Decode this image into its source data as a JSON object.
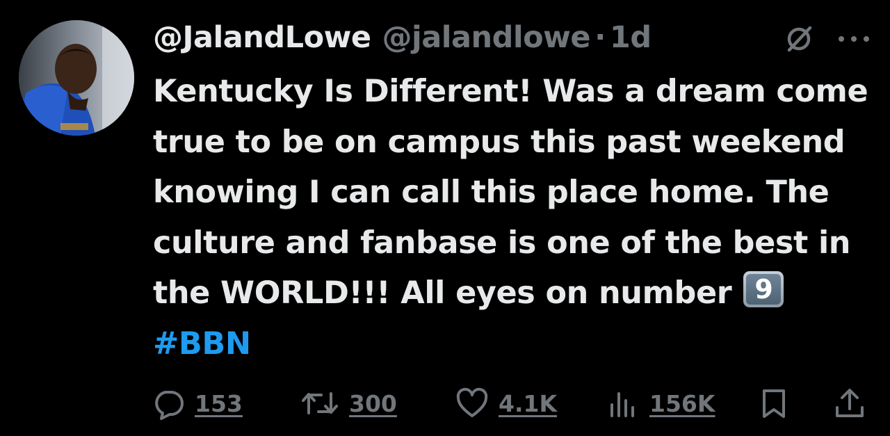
{
  "author": {
    "display_name": "@JalandLowe",
    "handle": "@jalandlowe",
    "separator": "·",
    "time": "1d",
    "avatar": "profile-photo"
  },
  "tweet": {
    "text_before": "Kentucky Is Different! Was a dream come true to be on campus this past weekend knowing I can call this place home. The culture and fanbase is one of the best in the WORLD!!! All eyes on number ",
    "keycap": "9",
    "hashtag": "#BBN"
  },
  "actions": {
    "replies": "153",
    "reposts": "300",
    "likes": "4.1K",
    "views": "156K"
  },
  "icons": {
    "reply": "comment-icon",
    "repost": "repost-icon",
    "like": "heart-icon",
    "views": "analytics-icon",
    "bookmark": "bookmark-icon",
    "share": "share-icon",
    "grok": "grok-icon",
    "more": "more-icon"
  },
  "colors": {
    "background": "#000000",
    "text": "#e7e9ea",
    "muted": "#71767b",
    "link": "#1d9bf0"
  }
}
